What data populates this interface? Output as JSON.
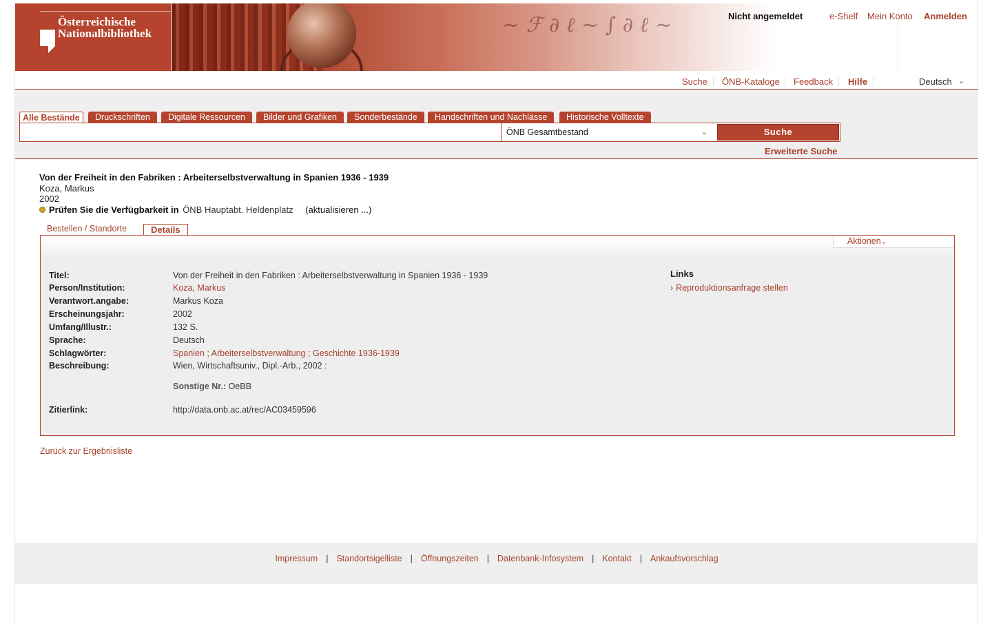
{
  "header": {
    "logo_line1": "Österreichische",
    "logo_line2": "Nationalbibliothek",
    "login_status": "Nicht angemeldet",
    "eshelf": "e-Shelf",
    "account": "Mein Konto",
    "login": "Anmelden"
  },
  "nav": {
    "items": [
      "Suche",
      "ÖNB-Kataloge",
      "Feedback",
      "Hilfe"
    ],
    "language": "Deutsch"
  },
  "search": {
    "tabs": [
      "Alle Bestände",
      "Druckschriften",
      "Digitale Ressourcen",
      "Bilder und Grafiken",
      "Sonderbestände",
      "Handschriften und Nachlässe",
      "Historische Volltexte"
    ],
    "query": "",
    "scope": "ÖNB Gesamtbestand",
    "button": "Suche",
    "advanced": "Erweiterte Suche"
  },
  "record": {
    "title": "Von der Freiheit in den Fabriken : Arbeiterselbstverwaltung in Spanien 1936 - 1939",
    "author": "Koza, Markus",
    "year": "2002",
    "availability_label": "Prüfen Sie die Verfügbarkeit in",
    "availability_location": "ÖNB Hauptabt. Heldenplatz",
    "availability_refresh": "(aktualisieren ...)",
    "tabs": [
      "Bestellen / Standorte",
      "Details"
    ],
    "actions_label": "Aktionen",
    "fields": {
      "titel_label": "Titel:",
      "titel": "Von der Freiheit in den Fabriken : Arbeiterselbstverwaltung in Spanien 1936 - 1939",
      "person_label": "Person/Institution:",
      "person": "Koza, Markus",
      "verantwort_label": "Verantwort.angabe:",
      "verantwort": "Markus Koza",
      "jahr_label": "Erscheinungsjahr:",
      "jahr": "2002",
      "umfang_label": "Umfang/Illustr.:",
      "umfang": "132 S.",
      "sprache_label": "Sprache:",
      "sprache": "Deutsch",
      "schlag_label": "Schlagwörter:",
      "schlag": [
        "Spanien",
        "Arbeiterselbstverwaltung",
        "Geschichte 1936-1939"
      ],
      "schlag_sep": ";",
      "beschreibung_label": "Beschreibung:",
      "beschreibung": "Wien, Wirtschaftsuniv., Dipl.-Arb., 2002 :",
      "sonstige_label": "Sonstige Nr.:",
      "sonstige": "OeBB",
      "zitierlink_label": "Zitierlink:",
      "zitierlink": "http://data.onb.ac.at/rec/AC03459596"
    },
    "links_title": "Links",
    "links": [
      "Reproduktionsanfrage stellen"
    ],
    "back": "Zurück zur Ergebnisliste"
  },
  "footer": {
    "links": [
      "Impressum",
      "Standortsigelliste",
      "Öffnungszeiten",
      "Datenbank-Infosystem",
      "Kontakt",
      "Ankaufsvorschlag"
    ],
    "separator": "|"
  },
  "colors": {
    "accent": "#b5432d",
    "link": "#a8412c",
    "panel": "#eeeeee"
  }
}
